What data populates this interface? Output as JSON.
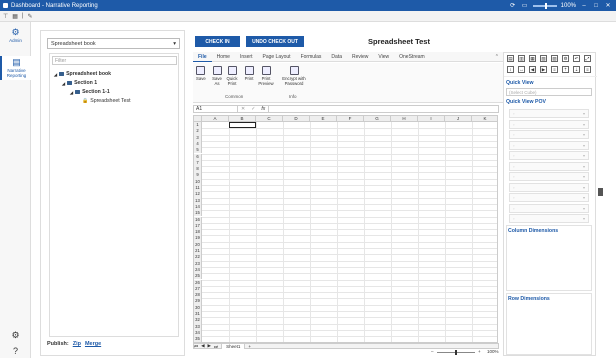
{
  "titlebar": {
    "title": "Dashboard - Narrative Reporting",
    "zoom": "100%"
  },
  "nav": {
    "admin": "Admin",
    "reporting": "Narrative Reporting"
  },
  "tree": {
    "book": "Spreadsheet book",
    "filter_placeholder": "Filter",
    "items": [
      {
        "label": "Spreadsheet book"
      },
      {
        "label": "Section 1"
      },
      {
        "label": "Section 1-1"
      },
      {
        "label": "Spreadsheet Test"
      }
    ],
    "publish_label": "Publish:",
    "zip": "Zip",
    "merge": "Merge"
  },
  "main": {
    "check_in": "CHECK IN",
    "undo_checkout": "UNDO CHECK OUT",
    "title": "Spreadsheet Test",
    "tabs": [
      "File",
      "Home",
      "Insert",
      "Page Layout",
      "Formulas",
      "Data",
      "Review",
      "View",
      "OneStream"
    ],
    "ribbon": {
      "save": "Save",
      "save_as": "Save As",
      "quick_print": "Quick Print",
      "print": "Print",
      "print_preview": "Print Preview",
      "encrypt": "Encrypt with Password",
      "group_common": "Common",
      "group_info": "Info"
    },
    "namebox": "A1",
    "fx": "fx",
    "columns": [
      "A",
      "B",
      "C",
      "D",
      "E",
      "F",
      "G",
      "H",
      "I",
      "J",
      "K"
    ],
    "rows": [
      "1",
      "2",
      "3",
      "4",
      "5",
      "6",
      "7",
      "8",
      "9",
      "10",
      "11",
      "12",
      "13",
      "14",
      "15",
      "16",
      "17",
      "18",
      "19",
      "20",
      "21",
      "22",
      "23",
      "24",
      "25",
      "26",
      "27",
      "28",
      "29",
      "30",
      "31",
      "32",
      "33",
      "34",
      "35"
    ],
    "sheet": "Sheet1",
    "zoom_pct": "100%"
  },
  "right": {
    "quick_view": "Quick View",
    "select_cube": "(Select Cube)",
    "pov": "Quick View POV",
    "col_dims": "Column Dimensions",
    "row_dims": "Row Dimensions"
  }
}
